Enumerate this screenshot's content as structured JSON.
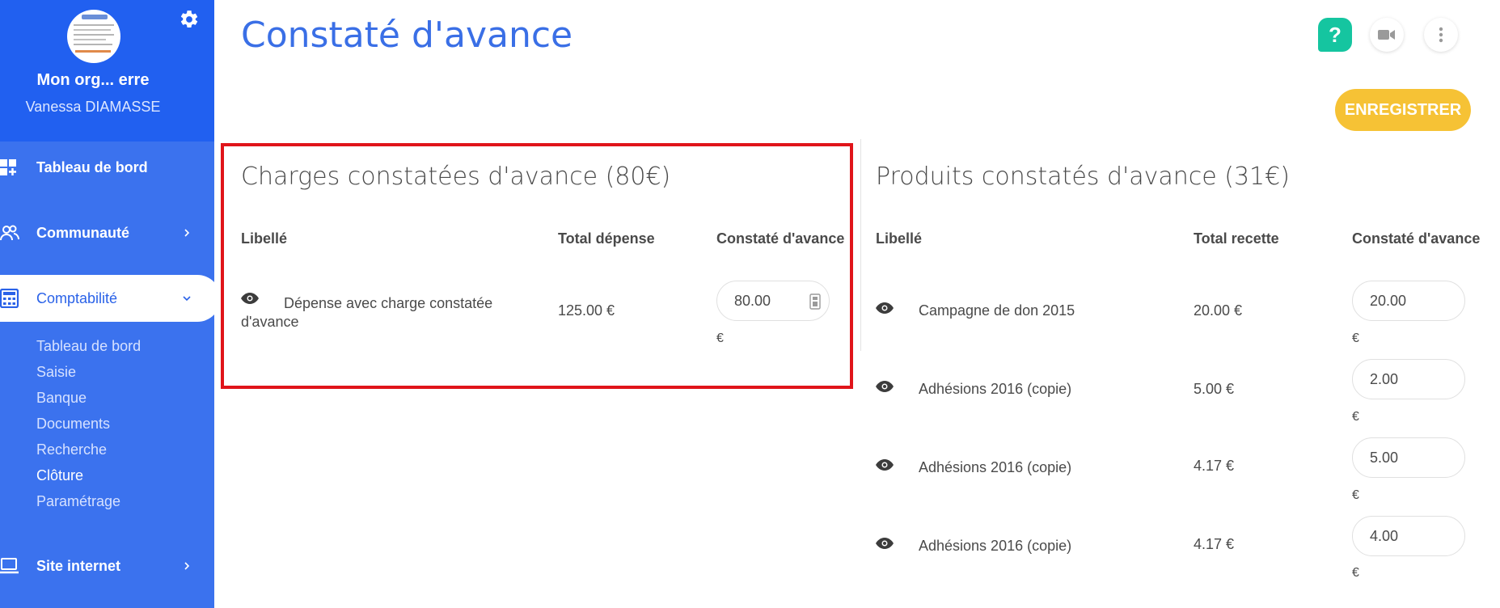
{
  "sidebar": {
    "org_name": "Mon org... erre",
    "user_name": "Vanessa DIAMASSE",
    "settings_icon": "gear-icon",
    "nav": [
      {
        "label": "Tableau de bord",
        "icon": "dashboard-icon"
      },
      {
        "label": "Communauté",
        "icon": "community-icon"
      },
      {
        "label": "Comptabilité",
        "icon": "calculator-icon"
      },
      {
        "label": "Site internet",
        "icon": "laptop-icon"
      }
    ],
    "sub_items": [
      "Tableau de bord",
      "Saisie",
      "Banque",
      "Documents",
      "Recherche",
      "Clôture",
      "Paramétrage"
    ]
  },
  "header": {
    "title": "Constaté d'avance",
    "help_label": "?",
    "save_label": "ENREGISTRER"
  },
  "charges": {
    "title": "Charges constatées d'avance (80€)",
    "columns": [
      "Libellé",
      "Total dépense",
      "Constaté d'avance"
    ],
    "rows": [
      {
        "label": "Dépense avec charge constatée d'avance",
        "total": "125.00 €",
        "value": "80.00",
        "currency": "€"
      }
    ]
  },
  "produits": {
    "title": "Produits constatés d'avance (31€)",
    "columns": [
      "Libellé",
      "Total recette",
      "Constaté d'avance"
    ],
    "rows": [
      {
        "label": "Campagne de don 2015",
        "total": "20.00 €",
        "value": "20.00",
        "currency": "€"
      },
      {
        "label": "Adhésions 2016 (copie)",
        "total": "5.00 €",
        "value": "2.00",
        "currency": "€"
      },
      {
        "label": "Adhésions 2016 (copie)",
        "total": "4.17 €",
        "value": "5.00",
        "currency": "€"
      },
      {
        "label": "Adhésions 2016 (copie)",
        "total": "4.17 €",
        "value": "4.00",
        "currency": "€"
      }
    ]
  },
  "colors": {
    "sidebar": "#3b72ee",
    "sidebar_head": "#2160f0",
    "title": "#3a6fe6",
    "save_button": "#f6c235",
    "help_button": "#15c5a0",
    "highlight": "#e0141a"
  }
}
